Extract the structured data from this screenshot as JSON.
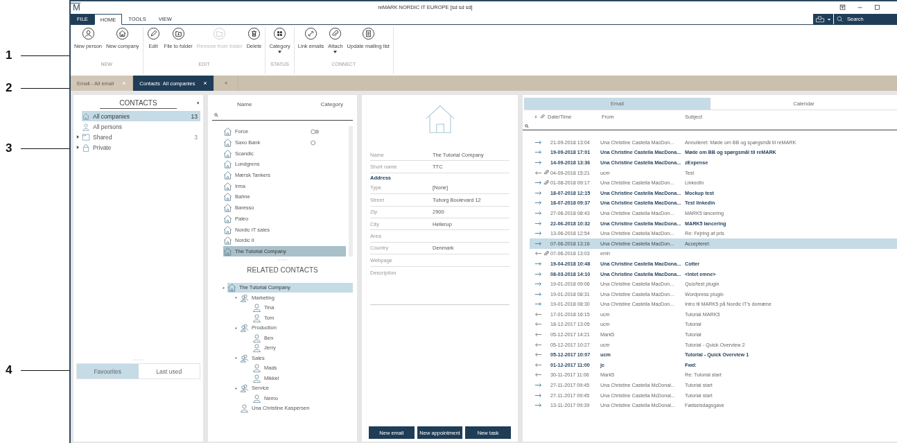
{
  "callouts": [
    "1",
    "2",
    "3",
    "4"
  ],
  "window": {
    "logo": "M",
    "title": "reMARK NORDIC IT EUROPE [sd sd sd]"
  },
  "menu_tabs": [
    {
      "label": "FILE",
      "kind": "file",
      "selected": false
    },
    {
      "label": "HOME",
      "kind": "tab",
      "selected": true
    },
    {
      "label": "TOOLS",
      "kind": "tab",
      "selected": false
    },
    {
      "label": "VIEW",
      "kind": "tab",
      "selected": false
    }
  ],
  "quick_search": {
    "placeholder": "Search"
  },
  "ribbon": [
    {
      "group": "NEW",
      "buttons": [
        {
          "label": "New person",
          "kind": "person",
          "disabled": false,
          "dropdown": false
        },
        {
          "label": "New company",
          "kind": "house",
          "disabled": false,
          "dropdown": false
        }
      ]
    },
    {
      "group": "EDIT",
      "buttons": [
        {
          "label": "Edit",
          "kind": "pencil",
          "disabled": false,
          "dropdown": false
        },
        {
          "label": "File to folder",
          "kind": "folder-in",
          "disabled": false,
          "dropdown": false
        },
        {
          "label": "Remove from folder",
          "kind": "folder",
          "disabled": true,
          "dropdown": false
        },
        {
          "label": "Delete",
          "kind": "trash",
          "disabled": false,
          "dropdown": false
        }
      ]
    },
    {
      "group": "STATUS",
      "buttons": [
        {
          "label": "Category",
          "kind": "grid",
          "disabled": false,
          "dropdown": true
        }
      ]
    },
    {
      "group": "CONNECT",
      "buttons": [
        {
          "label": "Link emails",
          "kind": "link",
          "disabled": false,
          "dropdown": false
        },
        {
          "label": "Attach",
          "kind": "clip",
          "disabled": false,
          "dropdown": true
        },
        {
          "label": "Update mailing list",
          "kind": "list",
          "disabled": false,
          "dropdown": false
        }
      ]
    }
  ],
  "doc_tabs": [
    {
      "label": "Email - All email",
      "selected": false
    },
    {
      "label": "Contacts  All companies",
      "selected": true
    }
  ],
  "new_tab": "+",
  "contacts": {
    "title": "CONTACTS",
    "tree": [
      {
        "label": "All companies",
        "kind": "companies",
        "count": "13",
        "selected": true
      },
      {
        "label": "All persons",
        "kind": "persons",
        "selected": false
      },
      {
        "label": "Shared",
        "kind": "folder",
        "count": "3",
        "expanded": false,
        "selected": false
      },
      {
        "label": "Private",
        "kind": "lock",
        "expanded": false,
        "selected": false
      }
    ],
    "bottom_tabs": [
      {
        "label": "Favourites",
        "selected": true
      },
      {
        "label": "Last used",
        "selected": false
      }
    ]
  },
  "company_list": {
    "columns": [
      "Name",
      "Category"
    ],
    "rows": [
      {
        "name": "Force",
        "kind": "toggle",
        "selected": false
      },
      {
        "name": "Saxo Bank",
        "kind": "circle",
        "selected": false
      },
      {
        "name": "Scandic",
        "kind": "plain",
        "selected": false
      },
      {
        "name": "Lundgrens",
        "kind": "plain",
        "selected": false
      },
      {
        "name": "Mærsk Tankers",
        "kind": "plain",
        "selected": false
      },
      {
        "name": "Irma",
        "kind": "plain",
        "selected": false
      },
      {
        "name": "Bahne",
        "kind": "plain",
        "selected": false
      },
      {
        "name": "Baresso",
        "kind": "plain",
        "selected": false
      },
      {
        "name": "Paleo",
        "kind": "plain",
        "selected": false
      },
      {
        "name": "Nordic IT sales",
        "kind": "plain",
        "selected": false
      },
      {
        "name": "Nordic II",
        "kind": "plain",
        "selected": false
      },
      {
        "name": "The Tutorial Company",
        "kind": "plain",
        "selected": true
      }
    ]
  },
  "related": {
    "title": "RELATED CONTACTS",
    "tree": [
      {
        "label": "The Tutorial Company",
        "kind": "company",
        "expanded": true,
        "selected": true,
        "children": [
          {
            "label": "Marketing",
            "kind": "group",
            "expanded": true,
            "selected": false,
            "children": [
              {
                "label": "Tina",
                "kind": "person",
                "selected": false
              },
              {
                "label": "Tom",
                "kind": "person",
                "selected": false
              }
            ]
          },
          {
            "label": "Production",
            "kind": "group",
            "expanded": true,
            "selected": false,
            "children": [
              {
                "label": "Ben",
                "kind": "person",
                "selected": false
              },
              {
                "label": "Jerry",
                "kind": "person",
                "selected": false
              }
            ]
          },
          {
            "label": "Sales",
            "kind": "group",
            "expanded": true,
            "selected": false,
            "children": [
              {
                "label": "Mads",
                "kind": "person",
                "selected": false
              },
              {
                "label": "Mikkel",
                "kind": "person",
                "selected": false
              }
            ]
          },
          {
            "label": "Service",
            "kind": "group",
            "expanded": true,
            "selected": false,
            "children": [
              {
                "label": "Nemo",
                "kind": "person",
                "selected": false
              }
            ]
          },
          {
            "label": "Una Christine Kaspersen",
            "kind": "person",
            "selected": false
          }
        ]
      }
    ]
  },
  "details": {
    "fields": [
      {
        "label": "Name",
        "kind": "field",
        "value": "The Tutorial Company"
      },
      {
        "label": "Short name",
        "kind": "field",
        "value": "TTC"
      },
      {
        "label": "Address",
        "kind": "heading"
      },
      {
        "label": "Type",
        "kind": "field",
        "value": "[None]"
      },
      {
        "label": "Street",
        "kind": "field",
        "value": "Tuborg Boulevard 12"
      },
      {
        "label": "Zip",
        "kind": "field",
        "value": "2900"
      },
      {
        "label": "City",
        "kind": "field",
        "value": "Hellerup"
      },
      {
        "label": "Area",
        "kind": "field"
      },
      {
        "label": "Country",
        "kind": "field",
        "value": "Denmark"
      },
      {
        "label": "Webpage",
        "kind": "field"
      },
      {
        "label": "Description",
        "kind": "multiline"
      }
    ],
    "buttons": [
      "New email",
      "New appointment",
      "New task"
    ]
  },
  "email": {
    "tabs": [
      {
        "label": "Email",
        "selected": true
      },
      {
        "label": "Calendar",
        "selected": false
      }
    ],
    "columns": [
      "Date/Time",
      "From",
      "Subject"
    ],
    "rows": [
      {
        "kind": "out",
        "attachment": false,
        "unread": false,
        "selected": false,
        "date": "21-09-2018 13:04",
        "from": "Una Christine Castella MacDon...",
        "subject": "Annulleret: Møde om BB og spørgsmål til reMARK"
      },
      {
        "kind": "out",
        "attachment": false,
        "unread": true,
        "selected": false,
        "date": "19-09-2018 17:01",
        "from": "Una Christine Castella MacDona...",
        "subject": "Møde om BB og spørgsmål til reMARK"
      },
      {
        "kind": "out",
        "attachment": false,
        "unread": true,
        "selected": false,
        "date": "14-09-2018 13:36",
        "from": "Una Christine Castella MacDona...",
        "subject": "zExpense"
      },
      {
        "kind": "in",
        "attachment": true,
        "unread": false,
        "selected": false,
        "date": "04-09-2018 15:21",
        "from": "ucm",
        "subject": "Test"
      },
      {
        "kind": "out",
        "attachment": true,
        "unread": false,
        "selected": false,
        "date": "01-08-2018 09:17",
        "from": "Una Christine Castella MacDon...",
        "subject": "LinkedIn"
      },
      {
        "kind": "out",
        "attachment": false,
        "unread": true,
        "selected": false,
        "date": "18-07-2018 12:15",
        "from": "Una Christine Castella MacDona...",
        "subject": "Mockup test"
      },
      {
        "kind": "out",
        "attachment": false,
        "unread": true,
        "selected": false,
        "date": "18-07-2018 09:37",
        "from": "Una Christine Castella MacDona...",
        "subject": "Test linkedin"
      },
      {
        "kind": "out",
        "attachment": false,
        "unread": false,
        "selected": false,
        "date": "27-06-2018 08:43",
        "from": "Una Christine Castella MacDon...",
        "subject": "MARK5 lancering"
      },
      {
        "kind": "out",
        "attachment": false,
        "unread": true,
        "selected": false,
        "date": "22-06-2018 10:32",
        "from": "Una Christine Castella MacDona...",
        "subject": "MARK5 lancering"
      },
      {
        "kind": "out",
        "attachment": false,
        "unread": false,
        "selected": false,
        "date": "13-06-2018 12:54",
        "from": "Una Christine Castella MacDon...",
        "subject": "Re: Fejring af pris"
      },
      {
        "kind": "out",
        "attachment": false,
        "unread": false,
        "selected": true,
        "date": "07-06-2018 13:16",
        "from": "Una Christine Castella MacDon...",
        "subject": "Accepteret:"
      },
      {
        "kind": "in",
        "attachment": true,
        "unread": false,
        "selected": false,
        "date": "07-06-2018 13:03",
        "from": "emh"
      },
      {
        "kind": "out",
        "attachment": false,
        "unread": true,
        "selected": false,
        "date": "19-04-2018 10:48",
        "from": "Una Christine Castella MacDona...",
        "subject": "Cotter"
      },
      {
        "kind": "out",
        "attachment": false,
        "unread": true,
        "selected": false,
        "date": "08-03-2018 14:10",
        "from": "Una Christine Castella MacDona...",
        "subject": "<intet emne>"
      },
      {
        "kind": "out",
        "attachment": false,
        "unread": false,
        "selected": false,
        "date": "19-01-2018 09:06",
        "from": "Una Christine Castella MacDon...",
        "subject": "Quiz/test plugin"
      },
      {
        "kind": "out",
        "attachment": false,
        "unread": false,
        "selected": false,
        "date": "19-01-2018 08:31",
        "from": "Una Christine Castella MacDon...",
        "subject": "Wordpress plugin"
      },
      {
        "kind": "out",
        "attachment": false,
        "unread": false,
        "selected": false,
        "date": "19-01-2018 08:30",
        "from": "Una Christine Castella MacDon...",
        "subject": "Intro til MARK5 på Nordic IT's domæne"
      },
      {
        "kind": "in",
        "attachment": false,
        "unread": false,
        "selected": false,
        "date": "17-01-2018 16:15",
        "from": "ucm",
        "subject": "Tutorial MARK5"
      },
      {
        "kind": "in",
        "attachment": false,
        "unread": false,
        "selected": false,
        "date": "18-12-2017 13:05",
        "from": "ucm",
        "subject": "Tutorial"
      },
      {
        "kind": "in",
        "attachment": false,
        "unread": false,
        "selected": false,
        "date": "05-12-2017 14:21",
        "from": "Mark5",
        "subject": "Tutorial"
      },
      {
        "kind": "in",
        "attachment": false,
        "unread": false,
        "selected": false,
        "date": "05-12-2017 10:27",
        "from": "ucm",
        "subject": "Tutorial - Quick Overview 2"
      },
      {
        "kind": "in",
        "attachment": false,
        "unread": true,
        "selected": false,
        "date": "05-12-2017 10:07",
        "from": "ucm",
        "subject": "Tutorial - Quick Overview 1"
      },
      {
        "kind": "in",
        "attachment": false,
        "unread": true,
        "selected": false,
        "date": "01-12-2017 11:00",
        "from": "jc",
        "subject": "Fwd:"
      },
      {
        "kind": "in",
        "attachment": false,
        "unread": false,
        "selected": false,
        "date": "30-11-2017 11:06",
        "from": "Mark5",
        "subject": "Re: Tutorial start"
      },
      {
        "kind": "out",
        "attachment": false,
        "unread": false,
        "selected": false,
        "date": "27-11-2017 09:45",
        "from": "Una Christine Castella McDonal...",
        "subject": "Tutorial start"
      },
      {
        "kind": "out",
        "attachment": false,
        "unread": false,
        "selected": false,
        "date": "27-11-2017 09:45",
        "from": "Una Christine Castella McDonal...",
        "subject": "Tutorial start"
      },
      {
        "kind": "out",
        "attachment": false,
        "unread": false,
        "selected": false,
        "date": "13-11-2017 09:39",
        "from": "Una Christine Castella McDonal...",
        "subject": "Fødselsdagsgave"
      }
    ]
  }
}
